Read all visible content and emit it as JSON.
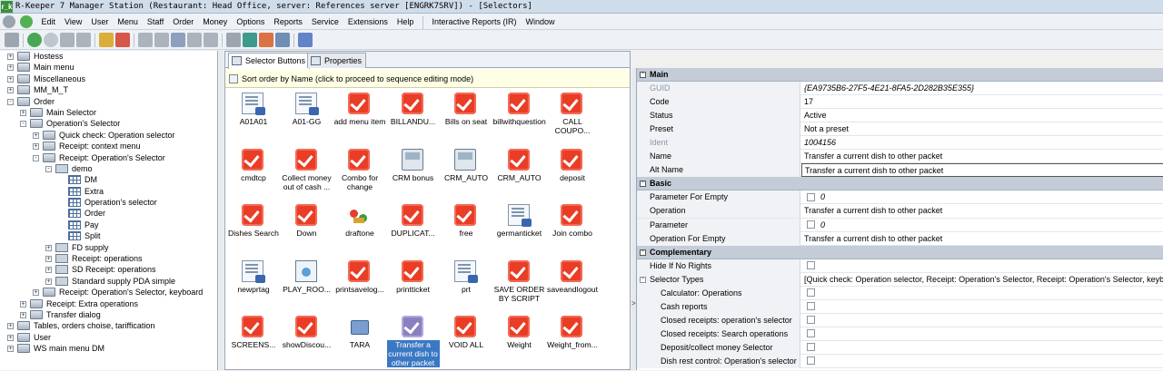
{
  "window": {
    "title": "R-Keeper 7 Manager Station (Restaurant: Head Office, server: References server [ENGRK7SRV]) - [Selectors]",
    "icon_label": "r_k"
  },
  "menu": {
    "items": [
      "Edit",
      "View",
      "User",
      "Menu",
      "Staff",
      "Order",
      "Money",
      "Options",
      "Reports",
      "Service",
      "Extensions",
      "Help"
    ],
    "extra": [
      "Interactive Reports (IR)",
      "Window"
    ]
  },
  "toolbar": {
    "icons": [
      "settings-icon",
      "back-icon",
      "forward-icon",
      "grid-icon",
      "grid2-icon",
      "export-icon",
      "cancel-icon",
      "save-icon",
      "doc-icon",
      "copy-icon",
      "cut-icon",
      "paste-icon",
      "search-icon",
      "refresh-icon",
      "flag-icon",
      "view-icon",
      "gear-icon"
    ]
  },
  "tree": {
    "nodes": [
      {
        "label": "Hostess",
        "level": 0,
        "expander": "+",
        "icon": "grp"
      },
      {
        "label": "Main menu",
        "level": 0,
        "expander": "+",
        "icon": "grp"
      },
      {
        "label": "Miscellaneous",
        "level": 0,
        "expander": "+",
        "icon": "grp"
      },
      {
        "label": "MM_M_T",
        "level": 0,
        "expander": "+",
        "icon": "grp"
      },
      {
        "label": "Order",
        "level": 0,
        "expander": "-",
        "icon": "grp"
      },
      {
        "label": "Main Selector",
        "level": 1,
        "expander": "+",
        "icon": "grp"
      },
      {
        "label": "Operation's Selector",
        "level": 1,
        "expander": "-",
        "icon": "grp"
      },
      {
        "label": "Quick check: Operation selector",
        "level": 2,
        "expander": "+",
        "icon": "grp"
      },
      {
        "label": "Receipt: context menu",
        "level": 2,
        "expander": "+",
        "icon": "grp"
      },
      {
        "label": "Receipt: Operation's Selector",
        "level": 2,
        "expander": "-",
        "icon": "grp"
      },
      {
        "label": "demo",
        "level": 3,
        "expander": "-",
        "icon": "fold"
      },
      {
        "label": "DM",
        "level": 4,
        "expander": "",
        "icon": "grid"
      },
      {
        "label": "Extra",
        "level": 4,
        "expander": "",
        "icon": "grid"
      },
      {
        "label": "Operation's selector",
        "level": 4,
        "expander": "",
        "icon": "grid"
      },
      {
        "label": "Order",
        "level": 4,
        "expander": "",
        "icon": "grid"
      },
      {
        "label": "Pay",
        "level": 4,
        "expander": "",
        "icon": "grid"
      },
      {
        "label": "Split",
        "level": 4,
        "expander": "",
        "icon": "grid"
      },
      {
        "label": "FD supply",
        "level": 3,
        "expander": "+",
        "icon": "fold"
      },
      {
        "label": "Receipt: operations",
        "level": 3,
        "expander": "+",
        "icon": "fold"
      },
      {
        "label": "SD Receipt: operations",
        "level": 3,
        "expander": "+",
        "icon": "fold"
      },
      {
        "label": "Standard supply PDA simple",
        "level": 3,
        "expander": "+",
        "icon": "fold"
      },
      {
        "label": "Receipt: Operation's Selector, keyboard",
        "level": 2,
        "expander": "+",
        "icon": "grp"
      },
      {
        "label": "Receipt: Extra operations",
        "level": 1,
        "expander": "+",
        "icon": "grp"
      },
      {
        "label": "Transfer dialog",
        "level": 1,
        "expander": "+",
        "icon": "grp"
      },
      {
        "label": "Tables, orders choise, tariffication",
        "level": 0,
        "expander": "+",
        "icon": "grp"
      },
      {
        "label": "User",
        "level": 0,
        "expander": "+",
        "icon": "grp"
      },
      {
        "label": "WS main menu DM",
        "level": 0,
        "expander": "+",
        "icon": "grp"
      }
    ]
  },
  "tabs": [
    {
      "label": "Selector Buttons",
      "active": true
    },
    {
      "label": "Properties",
      "active": false
    }
  ],
  "sortbar": {
    "text": "Sort order by Name (click to proceed to sequence editing mode)"
  },
  "buttons": [
    {
      "label": "A01A01",
      "icon": "doc"
    },
    {
      "label": "A01-GG",
      "icon": "doc"
    },
    {
      "label": "add menu item",
      "icon": "red"
    },
    {
      "label": "BILLANDU...",
      "icon": "red"
    },
    {
      "label": "Bills on seat",
      "icon": "red"
    },
    {
      "label": "billwithquestion",
      "icon": "red"
    },
    {
      "label": "CALL COUPO...",
      "icon": "red"
    },
    {
      "label": "cmdtcp",
      "icon": "red"
    },
    {
      "label": "Collect money out of cash ...",
      "icon": "red"
    },
    {
      "label": "Combo for change",
      "icon": "red"
    },
    {
      "label": "CRM bonus",
      "icon": "pcb"
    },
    {
      "label": "CRM_AUTO",
      "icon": "pcb"
    },
    {
      "label": "CRM_AUTO",
      "icon": "red"
    },
    {
      "label": "deposit",
      "icon": "red"
    },
    {
      "label": "Dishes Search",
      "icon": "red"
    },
    {
      "label": "Down",
      "icon": "red"
    },
    {
      "label": "draftone",
      "icon": "flow"
    },
    {
      "label": "DUPLICAT...",
      "icon": "red"
    },
    {
      "label": "free",
      "icon": "red"
    },
    {
      "label": "germanticket",
      "icon": "doc"
    },
    {
      "label": "Join combo",
      "icon": "red"
    },
    {
      "label": "newprtag",
      "icon": "doc"
    },
    {
      "label": "PLAY_ROO...",
      "icon": "clock"
    },
    {
      "label": "printsavelog...",
      "icon": "red"
    },
    {
      "label": "printticket",
      "icon": "red"
    },
    {
      "label": "prt",
      "icon": "doc"
    },
    {
      "label": "SAVE ORDER BY SCRIPT",
      "icon": "red"
    },
    {
      "label": "saveandlogout",
      "icon": "red"
    },
    {
      "label": "SCREENS...",
      "icon": "red"
    },
    {
      "label": "showDiscou...",
      "icon": "red"
    },
    {
      "label": "TARA",
      "icon": "tara"
    },
    {
      "label": "Transfer a current dish to other packet",
      "icon": "purp",
      "selected": true
    },
    {
      "label": "VOID ALL",
      "icon": "red"
    },
    {
      "label": "Weight",
      "icon": "red"
    },
    {
      "label": "Weight_from...",
      "icon": "red"
    }
  ],
  "props": {
    "cat_main": "Main",
    "main": [
      {
        "name": "GUID",
        "value": "{EA9735B6-27F5-4E21-8FA5-2D282B35E355}",
        "disabled": true,
        "italic": true
      },
      {
        "name": "Code",
        "value": "17"
      },
      {
        "name": "Status",
        "value": "Active"
      },
      {
        "name": "Preset",
        "value": "Not a preset"
      },
      {
        "name": "Ident",
        "value": "1004156",
        "disabled": true,
        "italic": true
      },
      {
        "name": "Name",
        "value": "Transfer a current dish to other packet"
      },
      {
        "name": "Alt Name",
        "value": "Transfer a current dish to other packet",
        "highlight": true
      }
    ],
    "cat_basic": "Basic",
    "basic": [
      {
        "name": "Parameter For Empty",
        "value": "0",
        "check": true
      },
      {
        "name": "Operation",
        "value": "Transfer a current dish to other packet"
      },
      {
        "name": "Parameter",
        "value": "0",
        "check": true
      },
      {
        "name": "Operation For Empty",
        "value": "Transfer a current dish to other packet"
      }
    ],
    "cat_comp": "Complementary",
    "comp": [
      {
        "name": "Hide If No Rights",
        "value": "",
        "check": true
      },
      {
        "name": "Selector Types",
        "value": "[Quick check: Operation selector, Receipt: Operation's Selector, Receipt: Operation's Selector, keyboard]",
        "expander": "-"
      },
      {
        "name": "Calculator: Operations",
        "value": "",
        "check": true,
        "sub": true
      },
      {
        "name": "Cash reports",
        "value": "",
        "check": true,
        "sub": true
      },
      {
        "name": "Closed receipts: operation's selector",
        "value": "",
        "check": true,
        "sub": true
      },
      {
        "name": "Closed receipts: Search operations",
        "value": "",
        "check": true,
        "sub": true
      },
      {
        "name": "Deposit/collect money Selector",
        "value": "",
        "check": true,
        "sub": true
      },
      {
        "name": "Dish rest control: Operation's selector",
        "value": "",
        "check": true,
        "sub": true
      }
    ]
  },
  "colors": {
    "accent": "#3b78c4",
    "red_icon": "#e93d26",
    "category": "#c3ccd7"
  }
}
